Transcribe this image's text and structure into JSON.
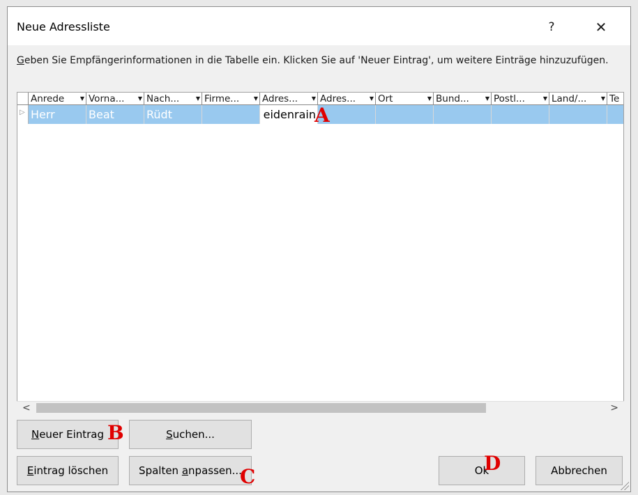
{
  "dialog": {
    "title": "Neue Adressliste",
    "help_label": "?",
    "close_label": "✕"
  },
  "instructions": {
    "accel": "G",
    "rest": "eben Sie Empfängerinformationen in die Tabelle ein. Klicken Sie auf 'Neuer Eintrag', um weitere Einträge hinzuzufügen."
  },
  "table": {
    "columns": [
      "Anrede",
      "Vorna...",
      "Nach...",
      "Firme...",
      "Adres...",
      "Adres...",
      "Ort",
      "Bund...",
      "Postl...",
      "Land/...",
      "Te"
    ],
    "row": [
      "Herr",
      "Beat",
      "Rüdt",
      "",
      "eidenrain",
      "",
      "",
      "",
      "",
      "",
      ""
    ],
    "row_indicator": "▷"
  },
  "scrollbar": {
    "left_arrow": "<",
    "right_arrow": ">"
  },
  "buttons": {
    "neuer_eintrag": {
      "accel": "N",
      "rest": "euer Eintrag"
    },
    "suchen": {
      "accel": "S",
      "rest": "uchen..."
    },
    "eintrag_loeschen": {
      "accel": "E",
      "rest": "intrag löschen"
    },
    "spalten_anpassen": {
      "pre": "Spalten ",
      "accel": "a",
      "rest": "npassen..."
    },
    "ok": "Ok",
    "abbrechen": "Abbrechen"
  },
  "markers": {
    "a": "A",
    "b": "B",
    "c": "C",
    "d": "D"
  },
  "colors": {
    "selection": "#99c9ef",
    "marker": "#e00000"
  }
}
